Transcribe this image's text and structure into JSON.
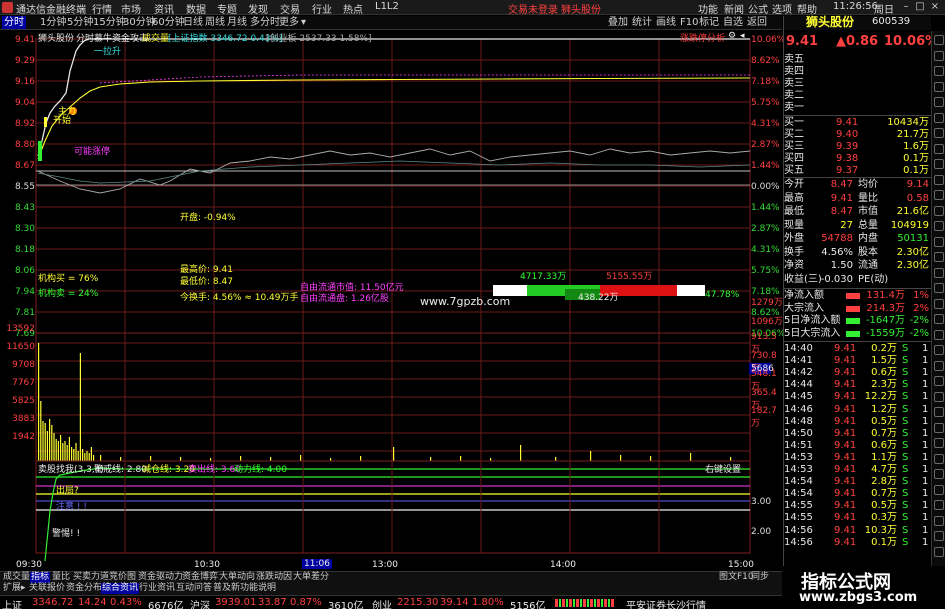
{
  "titlebar": {
    "app_title": "通达信金融终端",
    "menu": [
      "行情",
      "市场",
      "资讯",
      "数据",
      "专题",
      "发现",
      "交易",
      "行业",
      "热点",
      "L1L2"
    ],
    "trade_login": "交易未登录",
    "stock_short": "狮头股份",
    "right_menu": [
      "功能",
      "新闻",
      "公式",
      "选项",
      "帮助"
    ],
    "clock": "11:26:56",
    "weekday": "周日"
  },
  "toolbar": {
    "tabs": [
      "分时",
      "1分钟",
      "5分钟",
      "15分钟",
      "30分钟",
      "60分钟",
      "日线",
      "周线",
      "月线",
      "多分时",
      "更多"
    ],
    "active_tab": "分时",
    "right_tools": [
      "叠加",
      "统计",
      "画线",
      "F10",
      "标记",
      "自选",
      "返回"
    ]
  },
  "chart": {
    "header_stock": "狮头股份",
    "header_mode": "分时",
    "header_indicator": "慕牛资金攻击",
    "header_vol": "成交量",
    "header_index": "[上证指数 3346.72 0.43%]",
    "header_chuang": "[创业板 2537.33 1.58%]",
    "header_right": "涨跌停分析",
    "price_left": [
      "9.41",
      "9.29",
      "9.16",
      "9.04",
      "8.92",
      "8.80",
      "8.67",
      "8.55",
      "8.43",
      "8.30",
      "8.18",
      "8.06",
      "7.94",
      "7.81",
      "7.69"
    ],
    "pct_right": [
      "10.06%",
      "8.62%",
      "7.18%",
      "5.75%",
      "4.31%",
      "2.87%",
      "1.44%",
      "0.00%",
      "1.44%",
      "2.87%",
      "4.31%",
      "5.75%",
      "7.18%",
      "8.62%",
      "10.06%"
    ],
    "vol_left": [
      "13592",
      "11650",
      "9708",
      "7767",
      "5825",
      "3883",
      "1942"
    ],
    "vol_right": [
      "1279万",
      "1096万",
      "913.5万",
      "730.8万",
      "548.1万",
      "365.4万",
      "182.7万"
    ],
    "vol_marker": "5686",
    "ann_labapult": "一拉升",
    "ann_zhuli": "主力",
    "ann_kaishi": "开始",
    "ann_kezhang": "可能涨停",
    "ann_kaipan": "开盘: -0.94%",
    "ann_high": "最高价: 9.41",
    "ann_low": "最低价: 8.47",
    "ann_turnover": "今换手: 4.56% ≈ 10.49万手",
    "ann_buy": "机构买 = 76%",
    "ann_sell": "机构卖 = 24%",
    "ann_cap": "自由流通市值: 11.50亿元",
    "ann_float": "自由流通盘: 1.26亿股",
    "bar_left": "4717.33万",
    "bar_right": "5155.55万",
    "bar_mid": "438.22万",
    "bar_pct": "47.78%",
    "watermark": "www.7gpzb.com",
    "ind_title": "卖股找我(3,3,4)",
    "ind_warn": "警戒线: 2.80",
    "ind_reduce": "减仓线: 3.20",
    "ind_sell": "卖出线: 3.60",
    "ind_power": "动力线: 4.00",
    "ind_setting": "右键设置",
    "ind_chu": "出局?",
    "ind_buy": "注意 ! !",
    "ind_alert": "警惕! !",
    "ind_axis": [
      "3.00",
      "2.00"
    ],
    "time_labels": [
      "09:30",
      "10:30",
      "11:06",
      "13:00",
      "14:00",
      "15:00"
    ]
  },
  "bottom_tabs": [
    "成交量",
    "指标",
    "量比",
    "买卖力道",
    "竞价图",
    "资金驱动力",
    "资金博弈",
    "大单动向",
    "涨跌动因",
    "大单差分"
  ],
  "active_bottom_tab": "指标",
  "mid_tabs": [
    "扩展▸",
    "关联报价",
    "资金分布",
    "综合资讯",
    "行业资讯",
    "互动问答",
    "普及新功能说明"
  ],
  "active_mid_tab": "综合资讯",
  "status": {
    "sh_label": "上证",
    "sh_val": "3346.72",
    "sh_chg": "14.24",
    "sh_pct": "0.43%",
    "sh_amt": "6676亿",
    "sz_label": "沪深",
    "sz_val": "3939.01",
    "sz_chg": "33.87",
    "sz_pct": "0.87%",
    "sz_amt": "3610亿",
    "cy_label": "创业",
    "cy_val": "2215.30",
    "cy_chg": "39.14",
    "cy_pct": "1.80%",
    "cy_amt": "5156亿",
    "broker": "平安证券长沙行情"
  },
  "quote": {
    "name": "狮头股份",
    "code": "600539",
    "price": "9.41",
    "chg": "▲0.86",
    "pct": "10.06%",
    "asks": [
      {
        "label": "卖五",
        "price": "",
        "vol": ""
      },
      {
        "label": "卖四",
        "price": "",
        "vol": ""
      },
      {
        "label": "卖三",
        "price": "",
        "vol": ""
      },
      {
        "label": "卖二",
        "price": "",
        "vol": ""
      },
      {
        "label": "卖一",
        "price": "",
        "vol": ""
      }
    ],
    "bids": [
      {
        "label": "买一",
        "price": "9.41",
        "vol": "10434万"
      },
      {
        "label": "买二",
        "price": "9.40",
        "vol": "21.7万"
      },
      {
        "label": "买三",
        "price": "9.39",
        "vol": "1.6万"
      },
      {
        "label": "买四",
        "price": "9.38",
        "vol": "0.1万"
      },
      {
        "label": "买五",
        "price": "9.37",
        "vol": "0.1万"
      }
    ],
    "stats": [
      {
        "l1": "今开",
        "v1": "8.47",
        "l2": "均价",
        "v2": "9.14"
      },
      {
        "l1": "最高",
        "v1": "9.41",
        "l2": "量比",
        "v2": "0.58"
      },
      {
        "l1": "最低",
        "v1": "8.47",
        "l2": "市值",
        "v2": "21.6亿"
      },
      {
        "l1": "现量",
        "v1": "27",
        "l2": "总量",
        "v2": "104919"
      },
      {
        "l1": "外盘",
        "v1": "54788",
        "l2": "内盘",
        "v2": "50131"
      },
      {
        "l1": "换手",
        "v1": "4.56%",
        "l2": "股本",
        "v2": "2.30亿"
      },
      {
        "l1": "净资",
        "v1": "1.50",
        "l2": "流通",
        "v2": "2.30亿"
      },
      {
        "l1": "收益(三)",
        "v1": "-0.030",
        "l2": "PE(动)",
        "v2": ""
      }
    ],
    "flows": [
      {
        "label": "净流入额",
        "val": "131.4万",
        "pct": "1%"
      },
      {
        "label": "大宗流入",
        "val": "214.3万",
        "pct": "2%"
      },
      {
        "label": "5日净流入额",
        "val": "-1647万",
        "pct": "-2%"
      },
      {
        "label": "5日大宗流入",
        "val": "-1559万",
        "pct": "-2%"
      }
    ],
    "ticks": [
      {
        "t": "14:40",
        "p": "9.41",
        "v": "0.2万",
        "s": "S",
        "n": "1"
      },
      {
        "t": "14:41",
        "p": "9.41",
        "v": "1.5万",
        "s": "S",
        "n": "1"
      },
      {
        "t": "14:42",
        "p": "9.41",
        "v": "0.6万",
        "s": "S",
        "n": "1"
      },
      {
        "t": "14:44",
        "p": "9.41",
        "v": "2.3万",
        "s": "S",
        "n": "1"
      },
      {
        "t": "14:45",
        "p": "9.41",
        "v": "12.2万",
        "s": "S",
        "n": "1"
      },
      {
        "t": "14:46",
        "p": "9.41",
        "v": "1.2万",
        "s": "S",
        "n": "1"
      },
      {
        "t": "14:48",
        "p": "9.41",
        "v": "0.5万",
        "s": "S",
        "n": "1"
      },
      {
        "t": "14:50",
        "p": "9.41",
        "v": "0.7万",
        "s": "S",
        "n": "1"
      },
      {
        "t": "14:51",
        "p": "9.41",
        "v": "0.6万",
        "s": "S",
        "n": "1"
      },
      {
        "t": "14:53",
        "p": "9.41",
        "v": "1.1万",
        "s": "S",
        "n": "1"
      },
      {
        "t": "14:53",
        "p": "9.41",
        "v": "4.7万",
        "s": "S",
        "n": "1"
      },
      {
        "t": "14:54",
        "p": "9.41",
        "v": "2.8万",
        "s": "S",
        "n": "1"
      },
      {
        "t": "14:54",
        "p": "9.41",
        "v": "0.7万",
        "s": "S",
        "n": "1"
      },
      {
        "t": "14:55",
        "p": "9.41",
        "v": "0.5万",
        "s": "S",
        "n": "1"
      },
      {
        "t": "14:55",
        "p": "9.41",
        "v": "0.3万",
        "s": "S",
        "n": "1"
      },
      {
        "t": "14:56",
        "p": "9.41",
        "v": "10.3万",
        "s": "S",
        "n": "1"
      },
      {
        "t": "14:56",
        "p": "9.41",
        "v": "0.1万",
        "s": "S",
        "n": "1"
      }
    ]
  },
  "watermark2": {
    "line1": "指标公式网",
    "line2": "www.zbgs3.com"
  },
  "colors": {
    "up": "#ff4040",
    "down": "#33ee33",
    "price_line": "#e8e8e8",
    "avg_line": "#ffff33",
    "bg": "#000000"
  }
}
